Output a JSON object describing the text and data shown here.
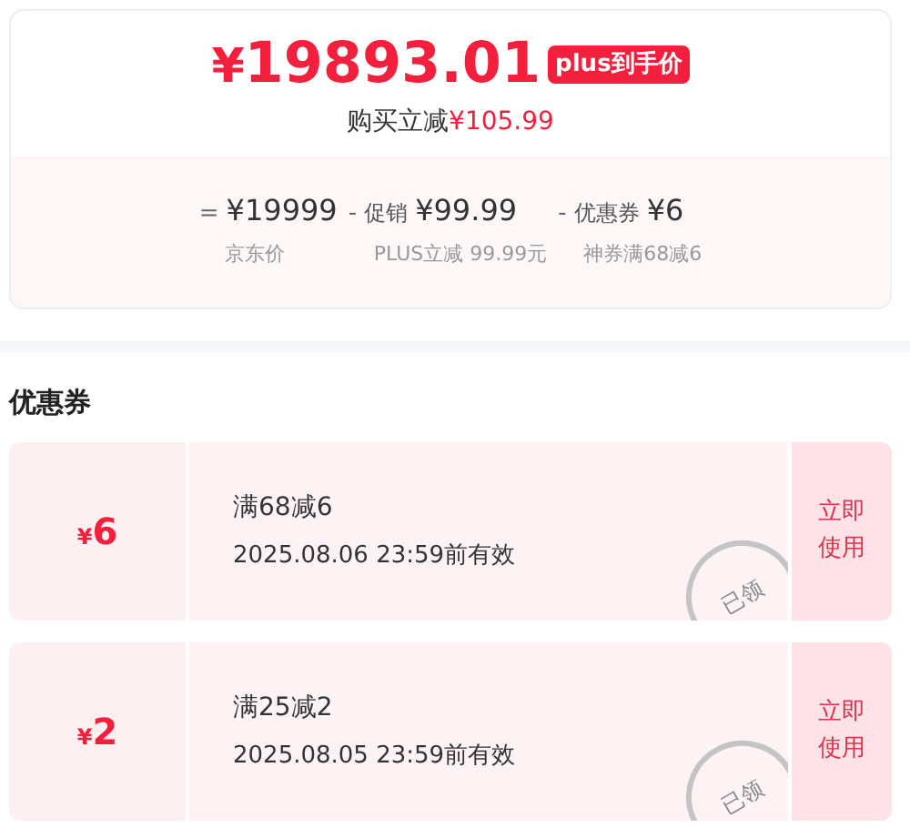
{
  "price": {
    "currency": "¥",
    "amount": "19893.01",
    "badge": "plus到手价",
    "saving_label": "购买立减",
    "saving": "¥105.99"
  },
  "breakdown": [
    {
      "op": "=",
      "value": "¥19999",
      "label": "京东价"
    },
    {
      "op": "-",
      "name": "促销",
      "value": "¥99.99",
      "label": "PLUS立减 99.99元"
    },
    {
      "op": "-",
      "name": "优惠券",
      "value": "¥6",
      "label": "神券满68减6"
    }
  ],
  "coupons_title": "优惠券",
  "coupons": [
    {
      "currency": "¥",
      "amount": "6",
      "rule": "满68减6",
      "validity": "2025.08.06 23:59前有效",
      "claimed": true,
      "stamp": "已领",
      "action": "立即使用"
    },
    {
      "currency": "¥",
      "amount": "2",
      "rule": "满25减2",
      "validity": "2025.08.05 23:59前有效",
      "claimed": true,
      "stamp": "已领",
      "action": "立即使用"
    }
  ]
}
